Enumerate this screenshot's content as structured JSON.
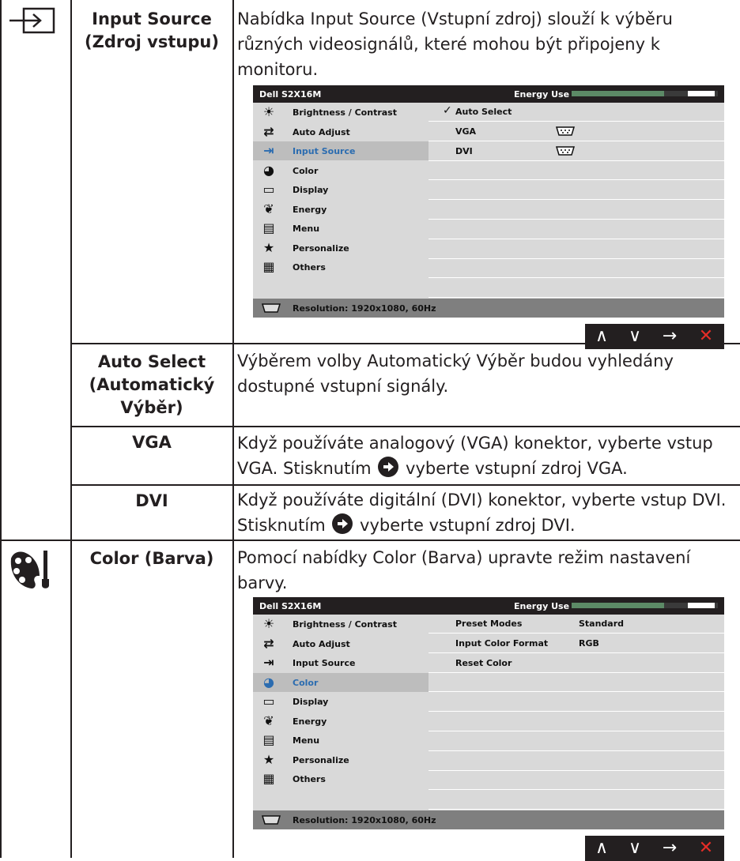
{
  "rows": [
    {
      "icon": "input-source-icon",
      "label_lines": [
        "Input Source",
        "(Zdroj vstupu)"
      ],
      "desc_lines": [
        "Nabídka Input Source (Vstupní zdroj) slouží k výběru",
        "různých videosignálů, které mohou být připojeny k",
        "monitoru."
      ]
    },
    {
      "label_lines": [
        "Auto Select",
        "(Automatický",
        "Výběr)"
      ],
      "desc_lines": [
        "Výběrem volby Automatický Výběr budou vyhledány",
        "dostupné vstupní signály."
      ]
    },
    {
      "label_lines": [
        "VGA"
      ],
      "desc_lines": [
        "Když používáte analogový (VGA) konektor, vyberte vstup",
        "VGA. Stisknutím",
        "vyberte vstupní zdroj VGA."
      ],
      "arrow_icon": "circle-arrow-right-icon"
    },
    {
      "label_lines": [
        "DVI"
      ],
      "desc_lines": [
        "Když používáte digitální (DVI) konektor, vyberte vstup DVI.",
        "Stisknutím",
        "vyberte vstupní zdroj DVI."
      ],
      "arrow_icon": "circle-arrow-right-icon"
    },
    {
      "icon": "color-palette-icon",
      "label_lines": [
        "Color (Barva)"
      ],
      "desc_lines": [
        "Pomocí nabídky Color (Barva) upravte režim nastavení",
        "barvy."
      ]
    }
  ],
  "osd": {
    "model": "Dell S2X16M",
    "energy_label": "Energy Use",
    "energy_level": 0.63,
    "menu_items": [
      {
        "label": "Brightness / Contrast",
        "icon": "brightness-icon",
        "glyph": "☀"
      },
      {
        "label": "Auto Adjust",
        "icon": "auto-adjust-icon",
        "glyph": "⇄"
      },
      {
        "label": "Input Source",
        "icon": "input-source-icon",
        "glyph": "⇥"
      },
      {
        "label": "Color",
        "icon": "color-palette-icon",
        "glyph": "◕"
      },
      {
        "label": "Display",
        "icon": "display-icon",
        "glyph": "▭"
      },
      {
        "label": "Energy",
        "icon": "energy-icon",
        "glyph": "❦"
      },
      {
        "label": "Menu",
        "icon": "menu-icon",
        "glyph": "▤"
      },
      {
        "label": "Personalize",
        "icon": "star-icon",
        "glyph": "★"
      },
      {
        "label": "Others",
        "icon": "others-icon",
        "glyph": "▦"
      }
    ],
    "status_text": "Resolution: 1920x1080, 60Hz",
    "nav_buttons": [
      "up-icon",
      "down-icon",
      "right-arrow-icon",
      "exit-icon"
    ],
    "screens": [
      {
        "active_index": 2,
        "rows": [
          {
            "c1": "Auto Select",
            "check": "✓"
          },
          {
            "c1": "VGA",
            "connector": "vga-connector-icon"
          },
          {
            "c1": "DVI",
            "connector": "dvi-connector-icon"
          }
        ]
      },
      {
        "active_index": 3,
        "rows": [
          {
            "c1": "Preset Modes",
            "c2": "Standard"
          },
          {
            "c1": "Input Color Format",
            "c2": "RGB"
          },
          {
            "c1": "Reset Color"
          }
        ]
      }
    ]
  },
  "colors": {
    "accent": "#2b6cb0",
    "exit": "#e52d27",
    "energy_fill": "#5c8a66"
  }
}
